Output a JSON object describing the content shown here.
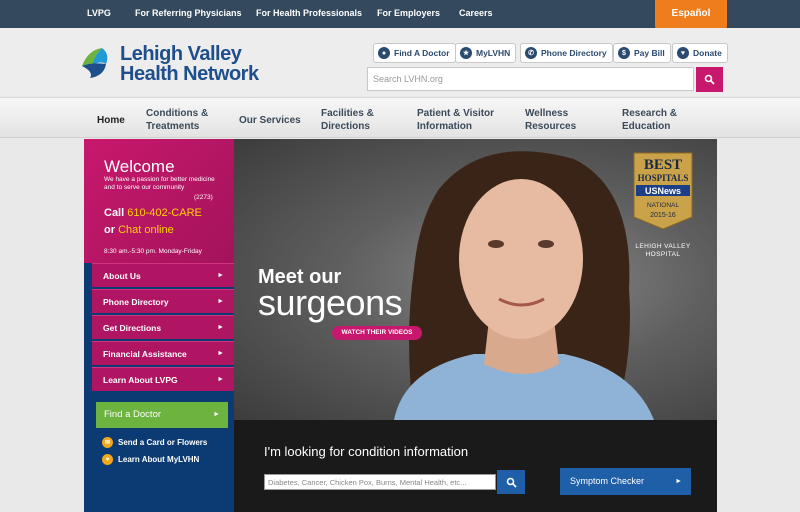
{
  "topbar": {
    "links": [
      "LVPG",
      "For Referring Physicians",
      "For Health Professionals",
      "For Employers",
      "Careers"
    ],
    "espanol": "Español",
    "bg_color": "#35495e",
    "accent_color": "#f07d1c"
  },
  "header": {
    "logo_line1": "Lehigh Valley",
    "logo_line2": "Health Network",
    "utility": [
      {
        "label": "Find A Doctor",
        "icon": "person-icon"
      },
      {
        "label": "MyLVHN",
        "icon": "star-icon"
      },
      {
        "label": "Phone Directory",
        "icon": "phone-icon"
      },
      {
        "label": "Pay Bill",
        "icon": "dollar-icon"
      },
      {
        "label": "Donate",
        "icon": "heart-icon"
      }
    ],
    "search_placeholder": "Search LVHN.org"
  },
  "nav": {
    "items": [
      {
        "line1": "Home",
        "line2": ""
      },
      {
        "line1": "Conditions &",
        "line2": "Treatments"
      },
      {
        "line1": "Our Services",
        "line2": ""
      },
      {
        "line1": "Facilities &",
        "line2": "Directions"
      },
      {
        "line1": "Patient & Visitor",
        "line2": "Information"
      },
      {
        "line1": "Wellness",
        "line2": "Resources"
      },
      {
        "line1": "Research &",
        "line2": "Education"
      }
    ]
  },
  "welcome": {
    "title": "Welcome",
    "subtitle": "We have a passion for better medicine and to serve our community",
    "ext": "(2273)",
    "call_prefix": "Call",
    "call_number": "610-402-CARE",
    "chat_prefix": "or",
    "chat_label": "Chat online",
    "hours": "8:30 am.-5:30 pm. Monday-Friday"
  },
  "sidebar": {
    "links": [
      "About Us",
      "Phone Directory",
      "Get Directions",
      "Financial Assistance",
      "Learn About LVPG"
    ],
    "find_doctor": "Find a Doctor",
    "mini_links": [
      "Send a Card or Flowers",
      "Learn About MyLVHN"
    ],
    "pink": "#b01564",
    "green": "#6cb33f"
  },
  "hero": {
    "title_line1": "Meet our",
    "title_line2": "surgeons",
    "cta": "WATCH THEIR VIDEOS",
    "badge_line1": "BEST",
    "badge_line2": "HOSPITALS",
    "badge_line3": "USNews",
    "badge_line4": "NATIONAL",
    "badge_line5": "2015-16",
    "badge_caption_1": "LEHIGH VALLEY",
    "badge_caption_2": "HOSPITAL"
  },
  "conditions": {
    "title": "I'm looking for condition information",
    "placeholder": "Diabetes, Cancer, Chicken Pox, Burns, Mental Health, etc...",
    "symptom_checker": "Symptom Checker"
  }
}
